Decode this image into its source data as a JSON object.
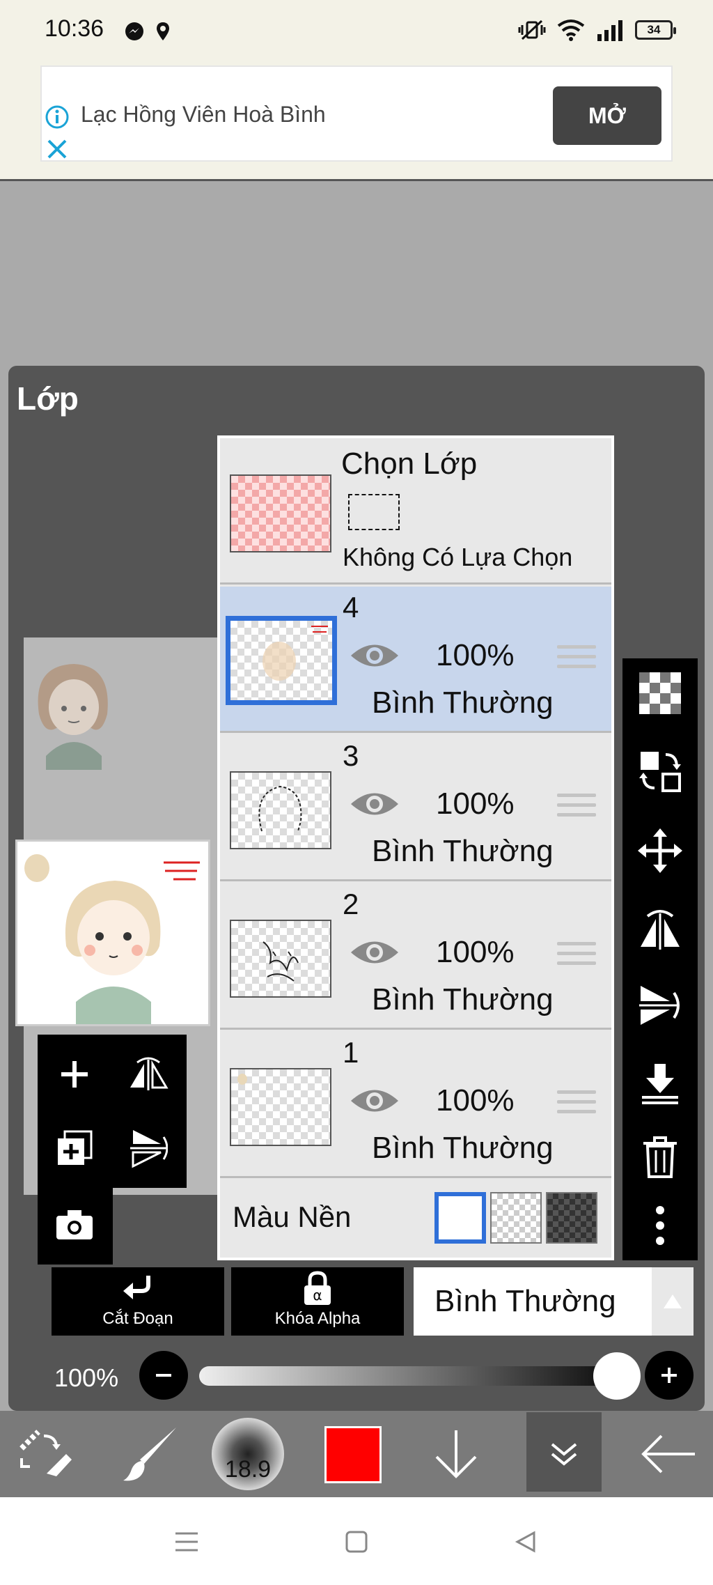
{
  "status_bar": {
    "time": "10:36",
    "battery": "34",
    "icons": [
      "messenger-icon",
      "location-icon",
      "mute-vibrate-icon",
      "wifi-icon",
      "signal-icon",
      "battery-icon"
    ]
  },
  "ad": {
    "title": "Lạc Hồng Viên Hoà Bình",
    "open_label": "MỞ",
    "icons": [
      "info-icon",
      "close-icon"
    ]
  },
  "layer_panel": {
    "title": "Lớp",
    "selection_layer": {
      "title": "Chọn Lớp",
      "subtitle": "Không Có Lựa Chọn"
    },
    "layers": [
      {
        "number": "4",
        "opacity": "100%",
        "blend": "Bình Thường",
        "active": true
      },
      {
        "number": "3",
        "opacity": "100%",
        "blend": "Bình Thường",
        "active": false
      },
      {
        "number": "2",
        "opacity": "100%",
        "blend": "Bình Thường",
        "active": false
      },
      {
        "number": "1",
        "opacity": "100%",
        "blend": "Bình Thường",
        "active": false
      }
    ],
    "background": {
      "label": "Màu Nền",
      "options": [
        "white",
        "transparent",
        "dark"
      ],
      "selected": "white"
    },
    "clip_label": "Cắt Đoạn",
    "alpha_lock_label": "Khóa Alpha",
    "blend_mode_value": "Bình Thường",
    "opacity_label": "100%",
    "opacity_value": 1.0
  },
  "toolbar": {
    "brush_size": "18.9",
    "current_color": "#ff0000"
  },
  "colors": {
    "accent": "#2f6fd8",
    "active_row": "#c8d6ec",
    "panel": "#555555"
  }
}
